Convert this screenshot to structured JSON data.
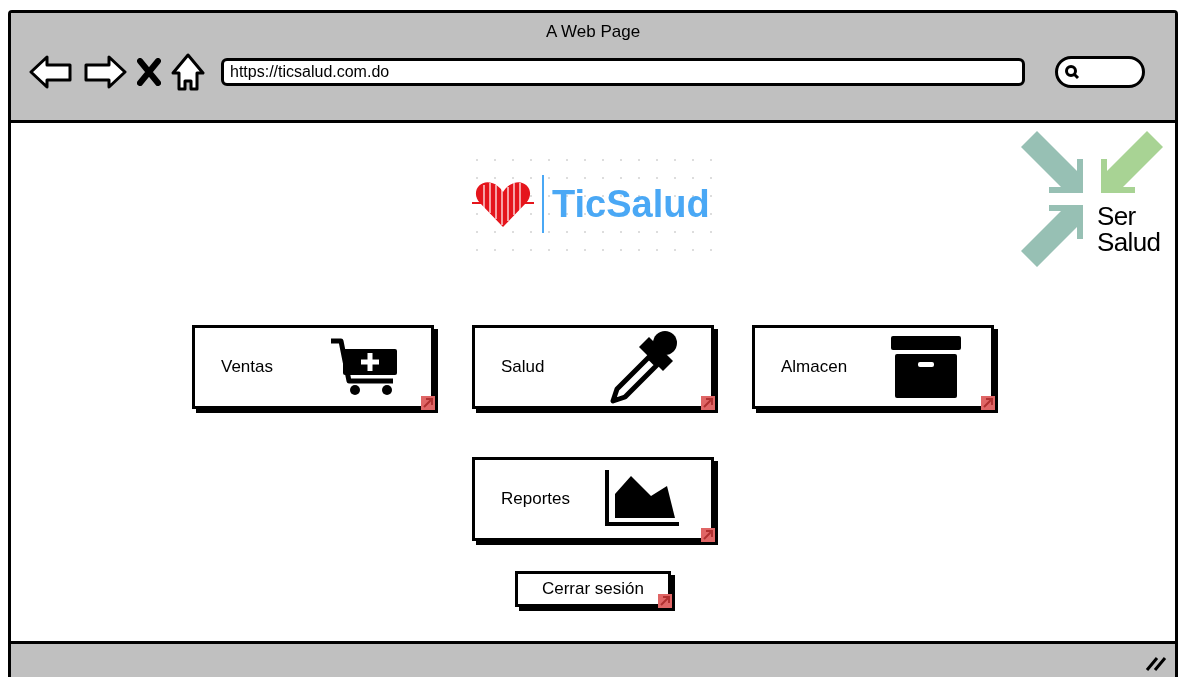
{
  "window": {
    "title": "A Web Page"
  },
  "address_bar": {
    "url": "https://ticsalud.com.do"
  },
  "logo": {
    "name": "TicSalud"
  },
  "partner_logo": {
    "line_1": "Ser",
    "line_2": "Salud"
  },
  "tiles": [
    {
      "label": "Ventas",
      "kind": "cart"
    },
    {
      "label": "Salud",
      "kind": "dropper"
    },
    {
      "label": "Almacen",
      "kind": "box"
    },
    {
      "label": "Reportes",
      "kind": "chart"
    }
  ],
  "logout_button": {
    "label": "Cerrar sesión"
  }
}
